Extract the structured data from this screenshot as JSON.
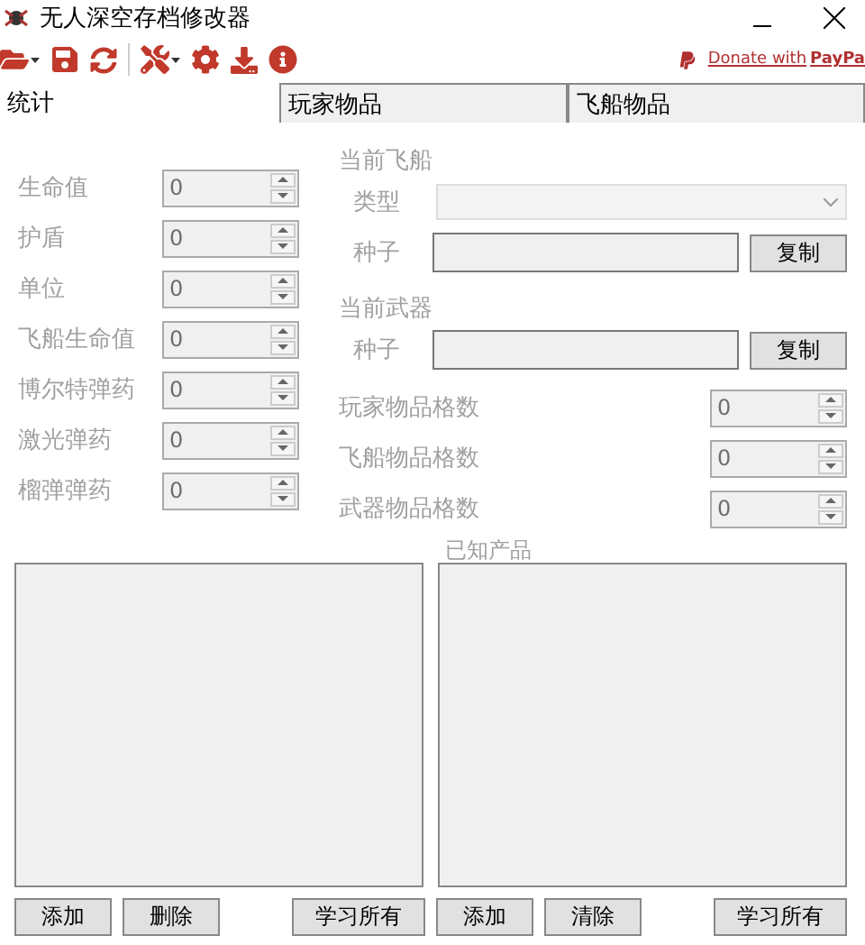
{
  "window": {
    "title": "无人深空存档修改器"
  },
  "toolbar": {
    "donate": "Donate with **PayPa**"
  },
  "tabs": [
    {
      "label": "统计",
      "selected": true
    },
    {
      "label": "玩家物品",
      "selected": false
    },
    {
      "label": "飞船物品",
      "selected": false
    }
  ],
  "stats_tab": {
    "disabled": true,
    "stats": [
      {
        "label": "生命值",
        "value": "0"
      },
      {
        "label": "护盾",
        "value": "0"
      },
      {
        "label": "单位",
        "value": "0"
      },
      {
        "label": "飞船生命值",
        "value": "0"
      },
      {
        "label": "博尔特弹药",
        "value": "0"
      },
      {
        "label": "激光弹药",
        "value": "0"
      },
      {
        "label": "榴弹弹药",
        "value": "0"
      }
    ],
    "ship": {
      "title": "当前飞船",
      "type_label": "类型",
      "seed_label": "种子",
      "copy_button": "复制"
    },
    "weapon": {
      "title": "当前武器",
      "seed_label": "种子",
      "copy_button": "复制"
    },
    "slots": [
      {
        "label": "玩家物品格数",
        "value": "0"
      },
      {
        "label": "飞船物品格数",
        "value": "0"
      },
      {
        "label": "武器物品格数",
        "value": "0"
      }
    ],
    "lists": [
      {
        "buttons": [
          "添加",
          "删除",
          "学习所有"
        ]
      },
      {
        "title": "已知产品",
        "buttons": [
          "添加",
          "清除",
          "学习所有"
        ]
      }
    ]
  }
}
